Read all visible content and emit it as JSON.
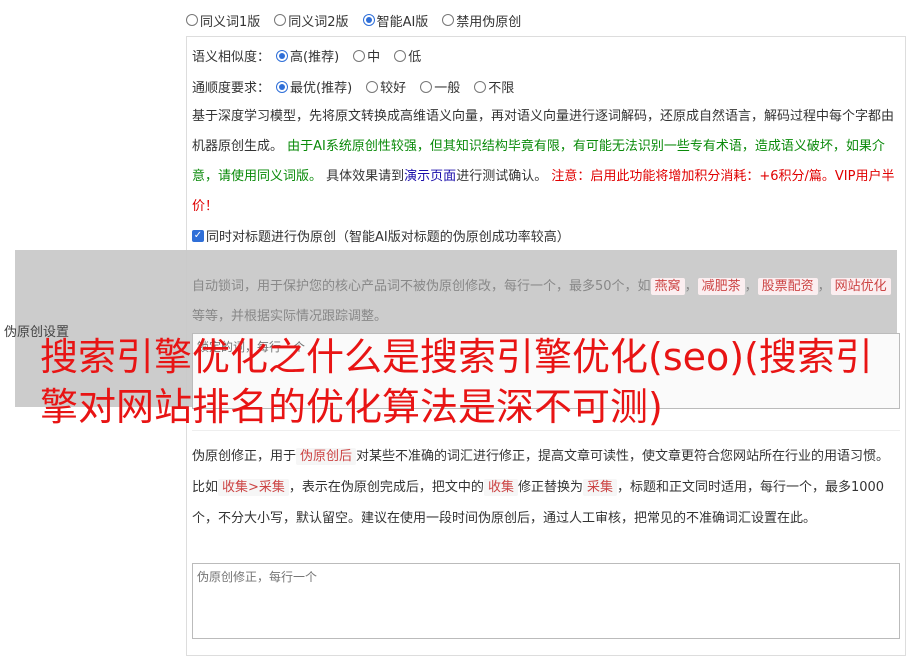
{
  "mode": {
    "options": [
      {
        "label": "同义词1版",
        "selected": false
      },
      {
        "label": "同义词2版",
        "selected": false
      },
      {
        "label": "智能AI版",
        "selected": true
      },
      {
        "label": "禁用伪原创",
        "selected": false
      }
    ]
  },
  "similarity": {
    "label": "语义相似度：",
    "options": [
      {
        "label": "高(推荐)",
        "selected": true
      },
      {
        "label": "中",
        "selected": false
      },
      {
        "label": "低",
        "selected": false
      }
    ]
  },
  "fluency": {
    "label": "通顺度要求：",
    "options": [
      {
        "label": "最优(推荐)",
        "selected": true
      },
      {
        "label": "较好",
        "selected": false
      },
      {
        "label": "一般",
        "selected": false
      },
      {
        "label": "不限",
        "selected": false
      }
    ]
  },
  "description": {
    "part1": "基于深度学习模型，先将原文转换成高维语义向量，再对语义向量进行逐词解码，还原成自然语言，解码过程中每个字都由机器原创生成。",
    "part2_green": "由于AI系统原创性较强，但其知识结构毕竟有限，有可能无法识别一些专有术语，造成语义破坏，如果介意，请使用同义词版。",
    "part3": "具体效果请到",
    "link": "演示页面",
    "part4": "进行测试确认。",
    "part5_red": "注意：启用此功能将增加积分消耗：+6积分/篇。VIP用户半价！"
  },
  "title_checkbox": {
    "checked": true,
    "label": "同时对标题进行伪原创（智能AI版对标题的伪原创成功率较高）"
  },
  "lock_words": {
    "desc_prefix": "自动锁词，用于保护您的核心产品词不被伪原创修改，每行一个，最多50个，如",
    "examples": [
      "燕窝",
      "减肥茶",
      "股票配资",
      "网站优化"
    ],
    "desc_suffix": "等等，并根据实际情况跟踪调整。",
    "placeholder": "锁定的词，每行一个"
  },
  "side_label": "伪原创设置",
  "overlay_title": "搜索引擎优化之什么是搜索引擎优化(seo)(搜索引擎对网站排名的优化算法是深不可测)",
  "fix": {
    "desc_1": "伪原创修正，用于",
    "tag_1": "伪原创后",
    "desc_2": "对某些不准确的词汇进行修正，提高文章可读性，使文章更符合您网站所在行业的用语习惯。比如",
    "tag_2": "收集>采集",
    "desc_3": "，表示在伪原创完成后，把文中的",
    "tag_3": "收集",
    "desc_4": "修正替换为",
    "tag_4": "采集",
    "desc_5": "，标题和正文同时适用，每行一个，最多1000个，不分大小写，默认留空。建议在使用一段时间伪原创后，通过人工审核，把常见的不准确词汇设置在此。",
    "placeholder": "伪原创修正，每行一个"
  },
  "colors": {
    "accent": "#2f6fd8",
    "green": "#0a8a0a",
    "red": "#e00000",
    "overlay_title": "#e81414"
  }
}
